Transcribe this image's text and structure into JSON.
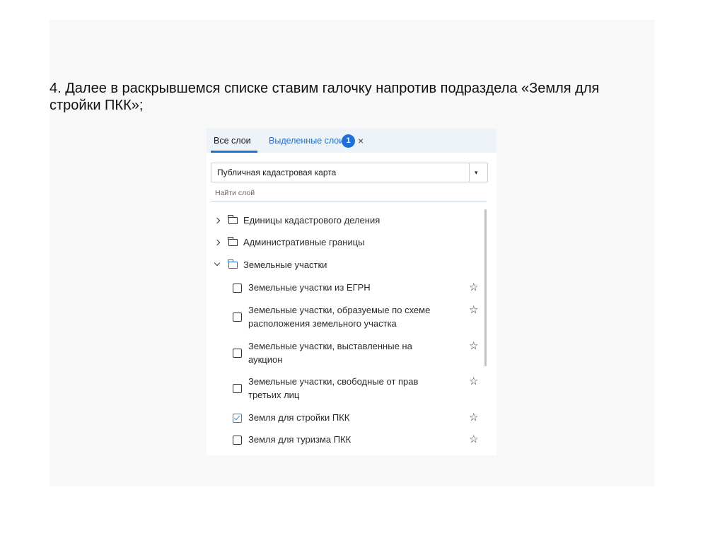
{
  "instruction": "4. Далее в раскрывшемся списке ставим галочку напротив подраздела «Земля для стройки ПКК»;",
  "tabs": {
    "all_layers": "Все слои",
    "selected_layers": "Выделенные слои",
    "selected_count": "1",
    "close": "×"
  },
  "map_select": {
    "value": "Публичная кадастровая карта",
    "arrow": "▾"
  },
  "search": {
    "placeholder": "Найти слой"
  },
  "tree": {
    "folders": [
      {
        "label": "Единицы кадастрового деления",
        "expanded": false
      },
      {
        "label": "Административные границы",
        "expanded": false
      },
      {
        "label": "Земельные участки",
        "expanded": true
      }
    ],
    "layers": [
      {
        "label": "Земельные участки из ЕГРН",
        "checked": false
      },
      {
        "label": "Земельные участки, образуемые по схеме расположения земельного участка",
        "checked": false
      },
      {
        "label": "Земельные участки, выставленные на аукцион",
        "checked": false
      },
      {
        "label": "Земельные участки, свободные от прав третьих лиц",
        "checked": false
      },
      {
        "label": "Земля для стройки ПКК",
        "checked": true
      },
      {
        "label": "Земля для туризма ПКК",
        "checked": false
      }
    ],
    "star_glyph": "☆"
  },
  "colors": {
    "accent": "#1e6fd9",
    "tab_bar": "#eef3f9",
    "page_background": "#f8f8f8"
  }
}
